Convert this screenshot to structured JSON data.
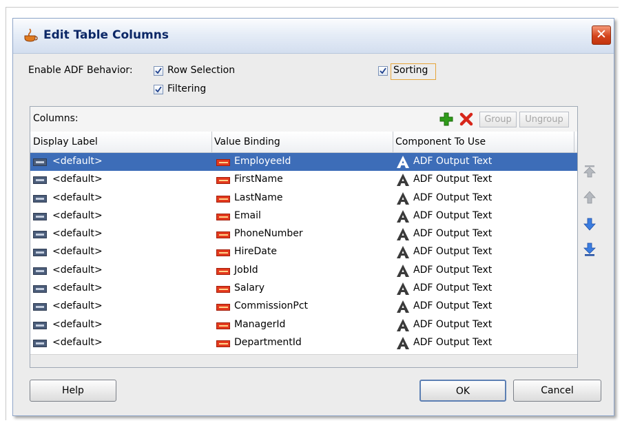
{
  "dialog": {
    "title": "Edit Table Columns",
    "close_glyph": "✕"
  },
  "behavior": {
    "label": "Enable ADF Behavior:",
    "row_selection": {
      "label": "Row Selection",
      "checked": true
    },
    "filtering": {
      "label": "Filtering",
      "checked": true
    },
    "sorting": {
      "label": "Sorting",
      "checked": true
    }
  },
  "columns_panel": {
    "label": "Columns:",
    "group_label": "Group",
    "ungroup_label": "Ungroup",
    "headers": [
      "Display Label",
      "Value Binding",
      "Component To Use"
    ],
    "rows": [
      {
        "display": "<default>",
        "binding": "EmployeeId",
        "component": "ADF Output Text",
        "selected": true
      },
      {
        "display": "<default>",
        "binding": "FirstName",
        "component": "ADF Output Text"
      },
      {
        "display": "<default>",
        "binding": "LastName",
        "component": "ADF Output Text"
      },
      {
        "display": "<default>",
        "binding": "Email",
        "component": "ADF Output Text"
      },
      {
        "display": "<default>",
        "binding": "PhoneNumber",
        "component": "ADF Output Text"
      },
      {
        "display": "<default>",
        "binding": "HireDate",
        "component": "ADF Output Text"
      },
      {
        "display": "<default>",
        "binding": "JobId",
        "component": "ADF Output Text"
      },
      {
        "display": "<default>",
        "binding": "Salary",
        "component": "ADF Output Text"
      },
      {
        "display": "<default>",
        "binding": "CommissionPct",
        "component": "ADF Output Text"
      },
      {
        "display": "<default>",
        "binding": "ManagerId",
        "component": "ADF Output Text"
      },
      {
        "display": "<default>",
        "binding": "DepartmentId",
        "component": "ADF Output Text"
      }
    ],
    "icons": [
      "add-icon",
      "delete-icon",
      "move-top-icon",
      "move-up-icon",
      "move-down-icon",
      "move-bottom-icon"
    ]
  },
  "footer": {
    "help_label": "Help",
    "ok_label": "OK",
    "cancel_label": "Cancel"
  },
  "colors": {
    "title_text": "#0b2766",
    "selection": "#3d6db8",
    "close_button": "#d4441c",
    "add_icon": "#2f9b1a",
    "delete_icon": "#d7261a",
    "move_arrow": "#2f6fd0"
  }
}
